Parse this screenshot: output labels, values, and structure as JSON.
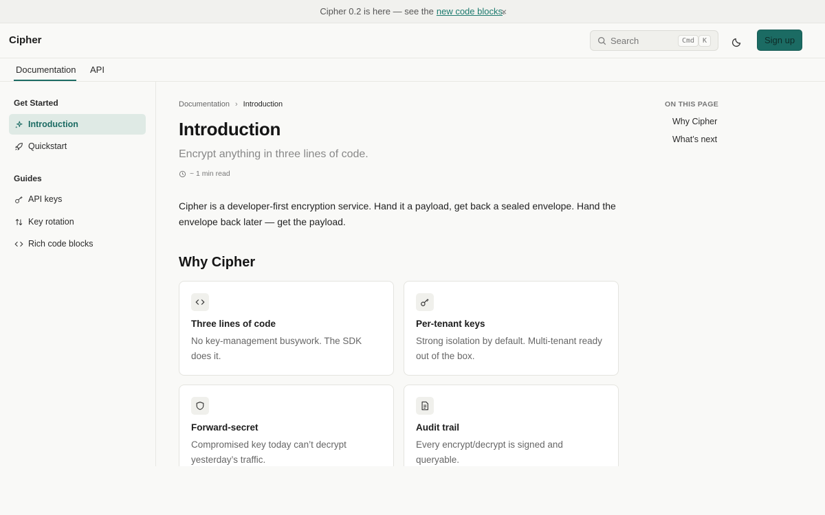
{
  "banner": {
    "text": "Cipher 0.2 is here — see the",
    "link": "new code blocks",
    "suffix": ".",
    "close": "×"
  },
  "header": {
    "logo": "Cipher",
    "search_placeholder": "Search",
    "kbd_cmd": "Cmd",
    "kbd_k": "K",
    "signup": "Sign up"
  },
  "tabs": [
    {
      "label": "Documentation",
      "active": true
    },
    {
      "label": "API",
      "active": false
    }
  ],
  "sidebar": {
    "sections": [
      {
        "title": "Get Started",
        "items": [
          {
            "label": "Introduction",
            "icon": "sparkles-icon",
            "active": true
          },
          {
            "label": "Quickstart",
            "icon": "rocket-icon",
            "active": false
          }
        ]
      },
      {
        "title": "Guides",
        "items": [
          {
            "label": "API keys",
            "icon": "key-icon",
            "active": false
          },
          {
            "label": "Key rotation",
            "icon": "arrows-up-down-icon",
            "active": false
          },
          {
            "label": "Rich code blocks",
            "icon": "code-icon",
            "active": false
          }
        ]
      }
    ]
  },
  "main": {
    "breadcrumb": [
      "Documentation",
      "Introduction"
    ],
    "title": "Introduction",
    "subtitle": "Encrypt anything in three lines of code.",
    "read_time": "~ 1 min read",
    "intro": "Cipher is a developer-first encryption service. Hand it a payload, get back a sealed envelope. Hand the envelope back later — get the payload.",
    "section_title": "Why Cipher",
    "cards": [
      {
        "icon": "code-icon",
        "title": "Three lines of code",
        "desc": "No key-management busywork. The SDK does it."
      },
      {
        "icon": "key-icon",
        "title": "Per-tenant keys",
        "desc": "Strong isolation by default. Multi-tenant ready out of the box."
      },
      {
        "icon": "shield-icon",
        "title": "Forward-secret",
        "desc": "Compromised key today can’t decrypt yesterday’s traffic."
      },
      {
        "icon": "document-icon",
        "title": "Audit trail",
        "desc": "Every encrypt/decrypt is signed and queryable."
      }
    ]
  },
  "toc": {
    "heading": "ON THIS PAGE",
    "items": [
      "Why Cipher",
      "What’s next"
    ]
  },
  "colors": {
    "accent": "#1b6b63",
    "active_bg": "#dfeae5",
    "page_bg": "#f9f9f7"
  }
}
